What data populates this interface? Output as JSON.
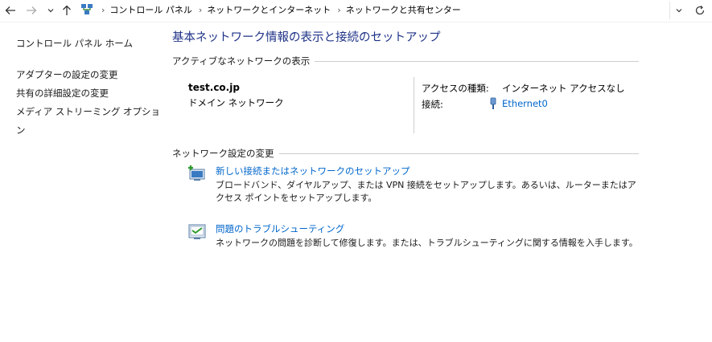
{
  "nav": {
    "back_icon": "arrow-left-icon",
    "forward_icon": "arrow-right-icon",
    "recent_icon": "chevron-down-icon",
    "up_icon": "arrow-up-icon",
    "refresh_icon": "refresh-icon"
  },
  "breadcrumb": [
    "コントロール パネル",
    "ネットワークとインターネット",
    "ネットワークと共有センター"
  ],
  "sidebar": {
    "home": "コントロール パネル ホーム",
    "links": [
      "アダプターの設定の変更",
      "共有の詳細設定の変更",
      "メディア ストリーミング オプション"
    ]
  },
  "main": {
    "title": "基本ネットワーク情報の表示と接続のセットアップ",
    "active_section": "アクティブなネットワークの表示",
    "network": {
      "name": "test.co.jp",
      "type": "ドメイン ネットワーク",
      "access_label": "アクセスの種類:",
      "access_value": "インターネット アクセスなし",
      "connection_label": "接続:",
      "connection_value": "Ethernet0"
    },
    "settings_section": "ネットワーク設定の変更",
    "tasks": [
      {
        "link": "新しい接続またはネットワークのセットアップ",
        "desc": "ブロードバンド、ダイヤルアップ、または VPN 接続をセットアップします。あるいは、ルーターまたはアクセス ポイントをセットアップします。"
      },
      {
        "link": "問題のトラブルシューティング",
        "desc": "ネットワークの問題を診断して修復します。または、トラブルシューティングに関する情報を入手します。"
      }
    ]
  },
  "colors": {
    "title": "#1e3287",
    "link": "#0066cc",
    "rule": "#cdcdcd"
  }
}
